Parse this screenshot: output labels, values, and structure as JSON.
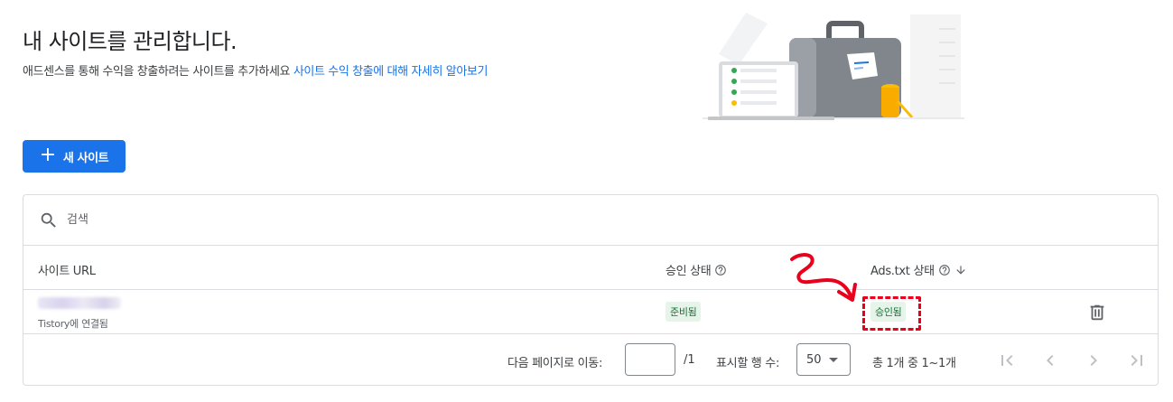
{
  "header": {
    "title": "내 사이트를 관리합니다.",
    "subtitle_text": "애드센스를 통해 수익을 창출하려는 사이트를 추가하세요 ",
    "subtitle_link": "사이트 수익 창출에 대해 자세히 알아보기"
  },
  "toolbar": {
    "new_site_plus": "+",
    "new_site_label": "새 사이트"
  },
  "search": {
    "placeholder": "검색",
    "value": ""
  },
  "table": {
    "columns": {
      "site_url": "사이트 URL",
      "approval_status": "승인 상태",
      "ads_txt_status": "Ads.txt 상태"
    },
    "rows": [
      {
        "url": "",
        "connection": "Tistory에 연결됨",
        "approval_status": "준비됨",
        "ads_txt_status": "승인됨"
      }
    ]
  },
  "pagination": {
    "goto_label": "다음 페이지로 이동:",
    "page_value": "",
    "total_pages": "/1",
    "rows_per_page_label": "표시할 행 수:",
    "rows_per_page_value": "50",
    "count_text": "총 1개 중 1~1개"
  },
  "icons": {
    "search": "search-icon",
    "help": "help-circle-icon",
    "sort": "arrow-down-icon",
    "delete": "trash-icon",
    "first_page": "first-page-icon",
    "prev_page": "chevron-left-icon",
    "next_page": "chevron-right-icon",
    "last_page": "last-page-icon"
  },
  "colors": {
    "primary": "#1a73e8",
    "chip_bg": "#e6f4ea",
    "chip_text": "#137333",
    "annotation": "#e8001c",
    "border": "#dadce0"
  }
}
